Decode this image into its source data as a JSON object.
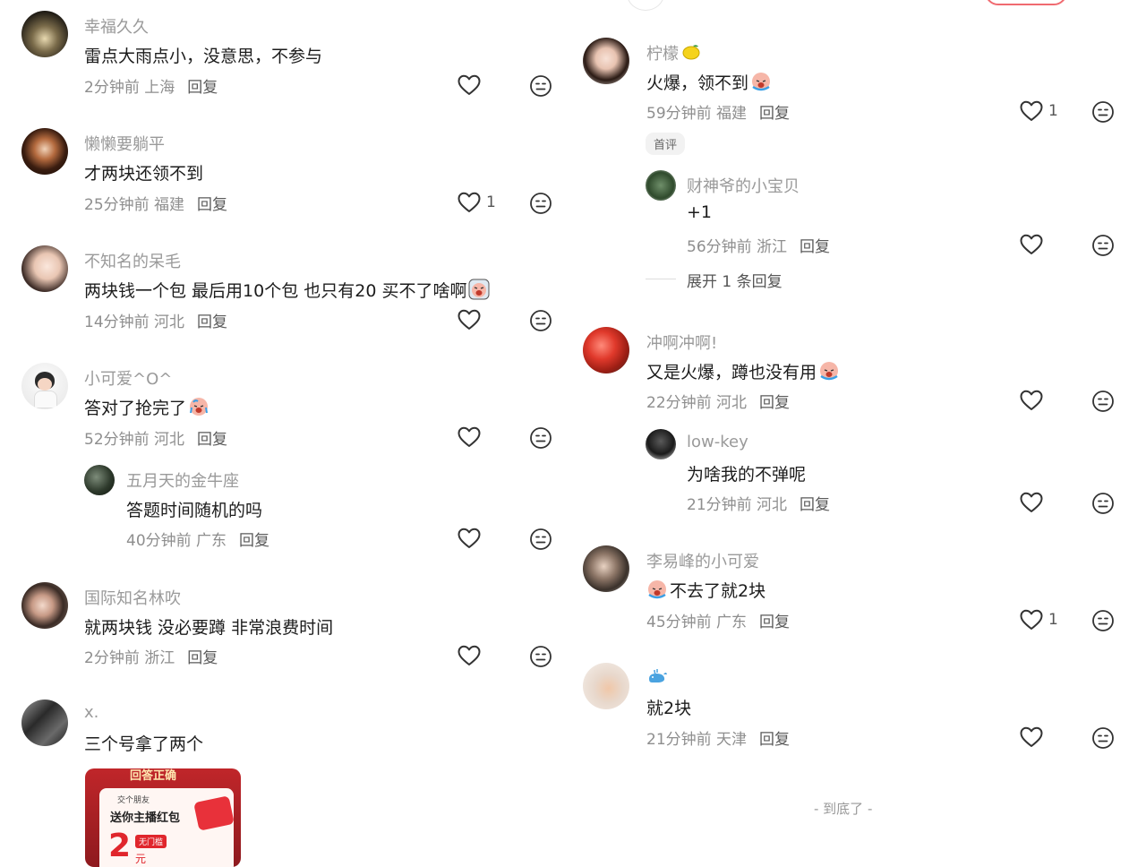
{
  "left": [
    {
      "user": "幸福久久",
      "text": "雷点大雨点小，没意思，不参与",
      "time": "2分钟前",
      "loc": "上海",
      "likes": ""
    },
    {
      "user": "懒懒要躺平",
      "text": "才两块还领不到",
      "time": "25分钟前",
      "loc": "福建",
      "likes": "1"
    },
    {
      "user": "不知名的呆毛",
      "text": "两块钱一个包  最后用10个包 也只有20 买不了啥啊",
      "time": "14分钟前",
      "loc": "河北",
      "likes": ""
    },
    {
      "user": "小可爱^O^",
      "text": "答对了抢完了",
      "time": "52分钟前",
      "loc": "河北",
      "likes": ""
    },
    {
      "user": "五月天的金牛座",
      "text": "答题时间随机的吗",
      "time": "40分钟前",
      "loc": "广东",
      "likes": ""
    },
    {
      "user": "国际知名林吹",
      "text": "就两块钱 没必要蹲 非常浪费时间",
      "time": "2分钟前",
      "loc": "浙江",
      "likes": ""
    },
    {
      "user": "x.",
      "text": "三个号拿了两个"
    }
  ],
  "right": [
    {
      "user": "柠檬",
      "text": "火爆，领不到",
      "time": "59分钟前",
      "loc": "福建",
      "likes": "1",
      "badge": "首评"
    },
    {
      "user": "财神爷的小宝贝",
      "text": "+1",
      "time": "56分钟前",
      "loc": "浙江",
      "likes": ""
    },
    {
      "user": "冲啊冲啊!",
      "text": "又是火爆，蹲也没有用",
      "time": "22分钟前",
      "loc": "河北",
      "likes": ""
    },
    {
      "user": "low-key",
      "text": "为啥我的不弹呢",
      "time": "21分钟前",
      "loc": "河北",
      "likes": ""
    },
    {
      "user": "李易峰的小可爱",
      "text": "不去了就2块",
      "time": "45分钟前",
      "loc": "广东",
      "likes": "1"
    },
    {
      "user": "",
      "text": "就2块",
      "time": "21分钟前",
      "loc": "天津",
      "likes": ""
    }
  ],
  "reply_label": "回复",
  "expand_label": "展开 1 条回复",
  "end_label": "- 到底了 -",
  "card": {
    "top": "回答正确",
    "tag": "交个朋友",
    "title": "送你主播红包",
    "amount": "2",
    "threshold": "无门槛",
    "unit": "元"
  },
  "colors": {
    "heart": "#333333",
    "text": "#1c1c1c",
    "meta": "#8e8e8e",
    "user": "#9a9a9a"
  }
}
